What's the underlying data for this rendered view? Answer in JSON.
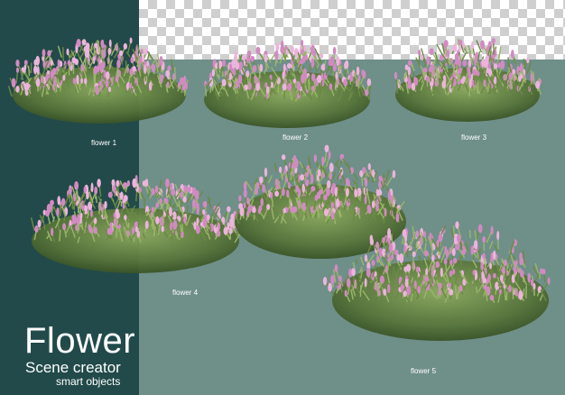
{
  "background": {
    "panel_color": "#224a4a",
    "canvas_color": "#6f8f89",
    "transparency_checker": [
      "#ffffff",
      "#cfcfcf"
    ]
  },
  "flowers": [
    {
      "label": "flower 1"
    },
    {
      "label": "flower 2"
    },
    {
      "label": "flower 3"
    },
    {
      "label": "flower 4"
    },
    {
      "label": "flower 5"
    }
  ],
  "branding": {
    "title": "Flower",
    "subtitle": "Scene creator",
    "tagline": "smart objects"
  },
  "colors": {
    "foliage_dark": "#3e5a2c",
    "foliage_mid": "#6b8a45",
    "foliage_light": "#9bb56b",
    "blossom": "#d28ac2",
    "blossom_light": "#ecb4dc"
  }
}
